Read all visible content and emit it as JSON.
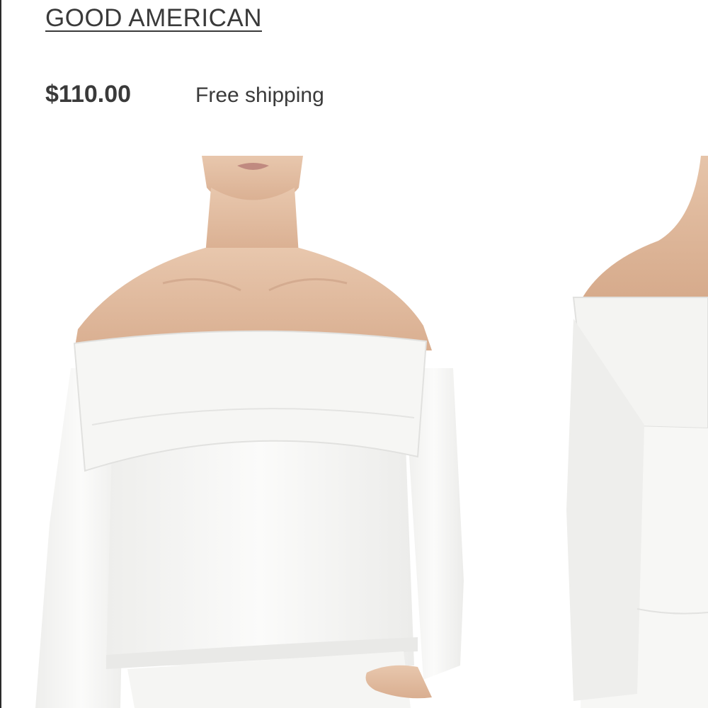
{
  "product": {
    "brand": "GOOD AMERICAN",
    "price": "$110.00",
    "shipping": "Free shipping"
  },
  "gallery": {
    "images": [
      {
        "name": "product-photo-front"
      },
      {
        "name": "product-photo-side"
      }
    ]
  },
  "colors": {
    "text": "#3a3a3a",
    "background": "#ffffff",
    "skin": "#e7c2a8",
    "garment": "#f7f7f5"
  }
}
